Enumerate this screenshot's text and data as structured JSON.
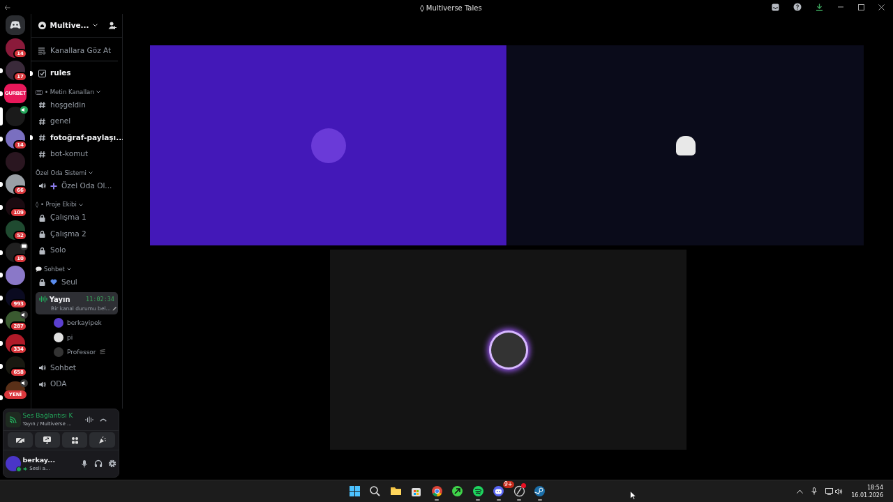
{
  "window": {
    "title": "Multiverse Tales"
  },
  "servers": [
    {
      "kind": "home",
      "color": "#2b2d31",
      "selected": false,
      "unread": false
    },
    {
      "kind": "server",
      "color": "#8a1a3a",
      "badge": "14",
      "selected": false,
      "unread": false
    },
    {
      "kind": "server",
      "color": "#3a2a3a",
      "badge": "17",
      "selected": false,
      "unread": true
    },
    {
      "kind": "server",
      "color": "#e8185a",
      "label": "GURBET",
      "selected": false,
      "unread": true
    },
    {
      "kind": "server",
      "color": "#1a1a1a",
      "voice": true,
      "selected": true,
      "unread": false
    },
    {
      "kind": "server",
      "color": "#7a6fc0",
      "badge": "14",
      "selected": false,
      "unread": true
    },
    {
      "kind": "server",
      "color": "#2a1620",
      "selected": false,
      "unread": false
    },
    {
      "kind": "server",
      "color": "#9aa0a6",
      "badge": "66",
      "selected": false,
      "unread": true
    },
    {
      "kind": "server",
      "color": "#1a0a10",
      "badge": "109",
      "selected": false,
      "unread": true
    },
    {
      "kind": "server",
      "color": "#1f4a30",
      "badge": "52",
      "selected": false,
      "unread": false
    },
    {
      "kind": "server",
      "color": "#202020",
      "badge": "10",
      "streaming": true,
      "selected": false,
      "unread": true
    },
    {
      "kind": "server",
      "color": "#8a78c8",
      "selected": false,
      "unread": true
    },
    {
      "kind": "server",
      "color": "#0a0a20",
      "badge": "993",
      "selected": false,
      "unread": true
    },
    {
      "kind": "server",
      "color": "#3a5a30",
      "badge": "287",
      "voice": true,
      "selected": false,
      "unread": true
    },
    {
      "kind": "server",
      "color": "#b01a28",
      "badge": "334",
      "selected": false,
      "unread": true
    },
    {
      "kind": "server",
      "color": "#181810",
      "badge": "658",
      "selected": false,
      "unread": true
    },
    {
      "kind": "server",
      "color": "#5a3018",
      "voice": true,
      "new_label": "YENİ",
      "selected": false,
      "unread": true
    }
  ],
  "sidebar": {
    "server_name": "Multive...",
    "items": [
      {
        "kind": "browse",
        "label": "Kanallara Göz At"
      },
      {
        "kind": "rules",
        "label": "rules",
        "unread": true
      },
      {
        "kind": "category",
        "label": "• Metin Kanalları"
      },
      {
        "kind": "text",
        "label": "hoşgeldin",
        "unread": false
      },
      {
        "kind": "text",
        "label": "genel",
        "unread": false
      },
      {
        "kind": "text",
        "label": "fotoğraf-paylaşı...",
        "unread": true
      },
      {
        "kind": "text",
        "label": "bot-komut",
        "unread": false
      },
      {
        "kind": "category",
        "label": "Özel Oda Sistemi"
      },
      {
        "kind": "voice",
        "label": "Özel Oda Ol..."
      },
      {
        "kind": "category",
        "label": "◊ • Proje Ekibi"
      },
      {
        "kind": "locked",
        "label": "Çalışma 1"
      },
      {
        "kind": "locked",
        "label": "Çalışma 2"
      },
      {
        "kind": "locked",
        "label": "Solo"
      },
      {
        "kind": "category",
        "label": "Sohbet"
      },
      {
        "kind": "locked",
        "label": "Seul"
      },
      {
        "kind": "live",
        "label": "Yayın",
        "time": "11:02:34",
        "status": "Bir kanal durumu bel...",
        "selected": true,
        "users": [
          {
            "name": "berkayipek",
            "color": "#5b3fd0"
          },
          {
            "name": "pi",
            "color": "#e0e0e0"
          },
          {
            "name": "Professor",
            "color": "#333333"
          }
        ]
      },
      {
        "kind": "voice",
        "label": "Sohbet"
      },
      {
        "kind": "voice",
        "label": "ODA"
      }
    ]
  },
  "voice_panel": {
    "status": "Ses Bağlantısı K",
    "channel": "Yayın / Multiverse ..."
  },
  "user_panel": {
    "name": "berkay...",
    "status": "Sesli a..."
  },
  "tiles": [
    {
      "color": "#4318b8",
      "speaking": false
    },
    {
      "color": "#0a0b1a",
      "speaking": false
    },
    {
      "color": "#141414",
      "speaking": true
    }
  ],
  "taskbar": {
    "apps": [
      {
        "kind": "start",
        "running": false
      },
      {
        "kind": "search",
        "running": false
      },
      {
        "kind": "folder",
        "running": false
      },
      {
        "kind": "store",
        "running": false
      },
      {
        "kind": "chrome",
        "running": true
      },
      {
        "kind": "green",
        "running": false
      },
      {
        "kind": "spotify",
        "running": true
      },
      {
        "kind": "discord",
        "running": true,
        "badge": "9+"
      },
      {
        "kind": "ring",
        "running": true,
        "alert": true
      },
      {
        "kind": "steam",
        "running": true
      }
    ],
    "time": "18:54",
    "date": "16.01.2026"
  }
}
